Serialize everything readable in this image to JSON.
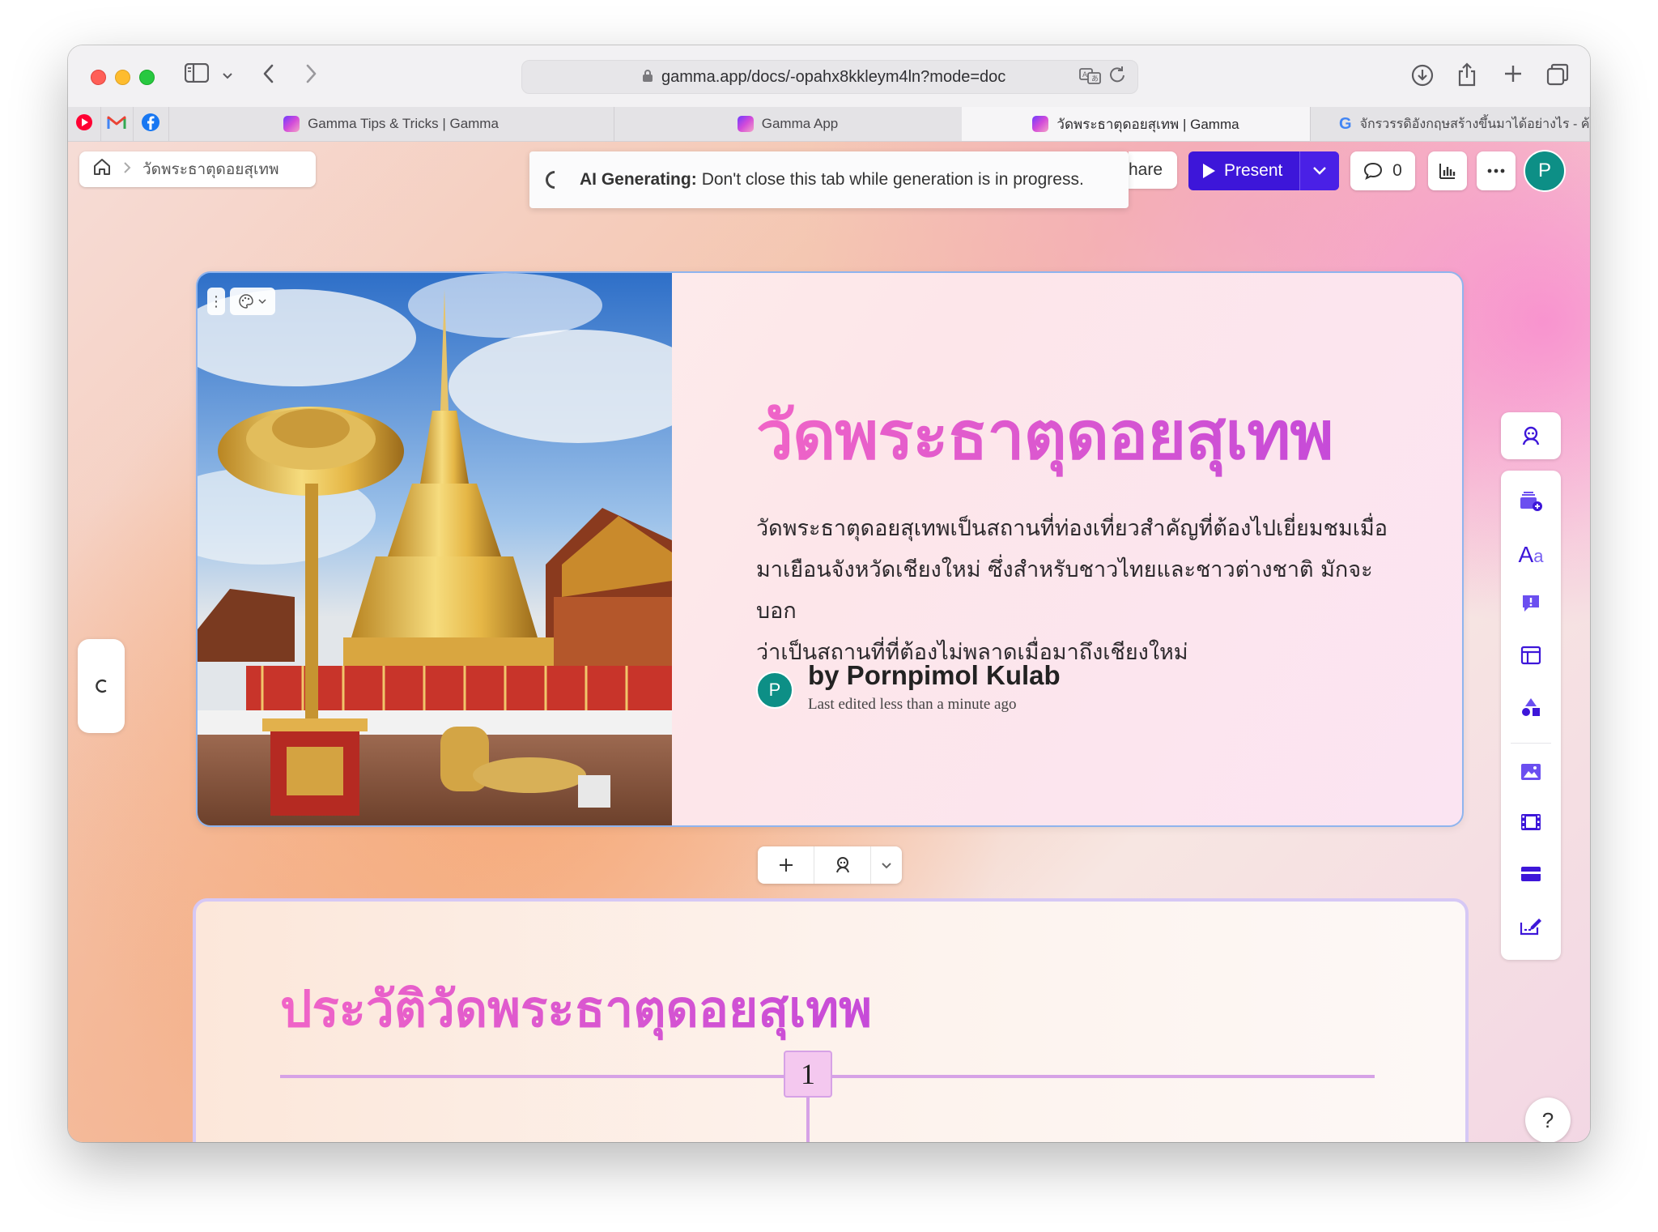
{
  "browser": {
    "url": "gamma.app/docs/-opahx8kkleym4ln?mode=doc",
    "tabs": [
      {
        "label": "Gamma Tips & Tricks | Gamma",
        "active": false
      },
      {
        "label": "Gamma App",
        "active": false
      },
      {
        "label": "วัดพระธาตุดอยสุเทพ | Gamma",
        "active": true
      },
      {
        "label": "จักรวรรดิอังกฤษสร้างขึ้นมาได้อย่างไร - ค้นหาด้...",
        "active": false
      }
    ],
    "pinned_tabs": [
      "youtube-icon",
      "gmail-icon",
      "facebook-icon"
    ]
  },
  "app": {
    "breadcrumb": {
      "page": "วัดพระธาตุดอยสุเทพ"
    },
    "generating": {
      "label": "AI Generating:",
      "message": "Don't close this tab while generation is in progress."
    },
    "share_label": "hare",
    "present_label": "Present",
    "comments_count": "0",
    "user_initial": "P",
    "accent": "#3d16d9"
  },
  "card1": {
    "title": "วัดพระธาตุดอยสุเทพ",
    "lines": [
      "วัดพระธาตุดอยสุเทพเป็นสถานที่ท่องเที่ยวสำคัญที่ต้องไปเยี่ยมชมเมื่อ",
      "มาเยือนจังหวัดเชียงใหม่ ซึ่งสำหรับชาวไทยและชาวต่างชาติ มักจะบอก",
      "ว่าเป็นสถานที่ที่ต้องไม่พลาดเมื่อมาถึงเชียงใหม่"
    ],
    "author": "by Pornpimol Kulab",
    "edited": "Last edited less than a minute ago",
    "author_initial": "P"
  },
  "card2": {
    "title": "ประวัติวัดพระธาตุดอยสุเทพ",
    "timeline_number": "1"
  },
  "help_label": "?"
}
